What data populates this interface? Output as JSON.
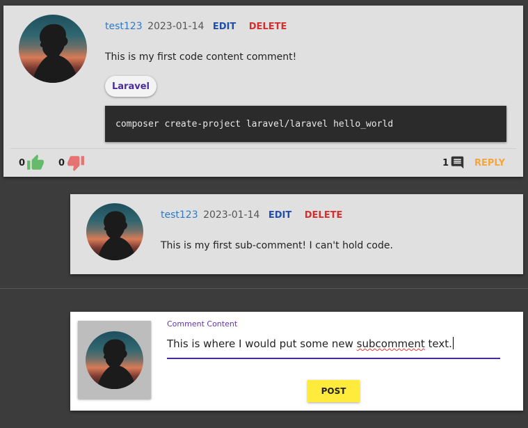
{
  "main_comment": {
    "author": "test123",
    "date": "2023-01-14",
    "edit_label": "EDIT",
    "delete_label": "DELETE",
    "text": "This is my first code content comment!",
    "tag": "Laravel",
    "code": "composer create-project laravel/laravel hello_world",
    "likes": "0",
    "dislikes": "0",
    "reply_count": "1",
    "reply_label": "REPLY"
  },
  "sub_comment": {
    "author": "test123",
    "date": "2023-01-14",
    "edit_label": "EDIT",
    "delete_label": "DELETE",
    "text": "This is my first sub-comment! I can't hold code."
  },
  "new_subcomment_form": {
    "label": "Comment Content",
    "value_before": "This is where I would put some new ",
    "value_misspelled": "subcomment",
    "value_after": " text.",
    "post_label": "POST"
  },
  "icons": {
    "like": "thumbs-up-icon",
    "dislike": "thumbs-down-icon",
    "replies": "comment-icon"
  },
  "colors": {
    "like": "#66bb6a",
    "dislike": "#e57373",
    "reply": "#f5a63a",
    "author": "#2f78c4",
    "edit": "#1f4fa8",
    "delete": "#d32f2f",
    "post_button": "#ffeb3b",
    "accent": "#4527a0"
  }
}
